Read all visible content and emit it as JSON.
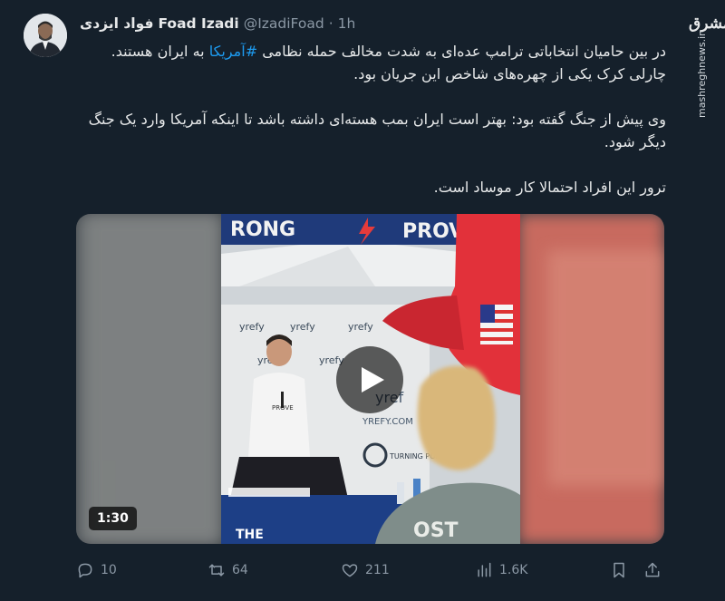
{
  "author": {
    "name": "Foad Izadi",
    "name_fa": "فواد ایزدی",
    "handle": "@IzadiFoad",
    "separator": "·",
    "time": "1h"
  },
  "watermark": {
    "logo": "مشرق",
    "url": "mashreghnews.ir"
  },
  "tweet": {
    "p1_before": "در بین حامیان انتخاباتی ترامپ عده‌ای به شدت مخالف حمله نظامی ",
    "hashtag": "#آمریکا",
    "p1_after": " به ایران هستند. چارلی کرک یکی از چهره‌های شاخص این جریان بود.",
    "p2": "وی پیش از جنگ گفته بود: بهتر است ایران بمب هسته‌ای داشته باشد تا اینکه آمریکا وارد یک جنگ دیگر شود.",
    "p3": "ترور این افراد احتمالا کار موساد است."
  },
  "video": {
    "duration": "1:30"
  },
  "actions": {
    "replies": "10",
    "retweets": "64",
    "likes": "211",
    "views": "1.6K"
  },
  "colors": {
    "background": "#15202b",
    "text": "#e7e9ea",
    "muted": "#8b98a5",
    "link": "#1d9bf0"
  }
}
